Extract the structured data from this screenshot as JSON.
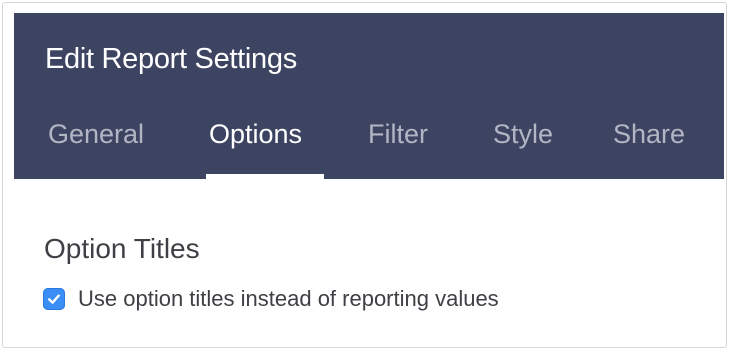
{
  "header": {
    "title": "Edit Report Settings",
    "tabs": [
      {
        "label": "General",
        "active": false
      },
      {
        "label": "Options",
        "active": true
      },
      {
        "label": "Filter",
        "active": false
      },
      {
        "label": "Style",
        "active": false
      },
      {
        "label": "Share",
        "active": false
      }
    ]
  },
  "content": {
    "section_title": "Option Titles",
    "option_titles_checkbox": {
      "label": "Use option titles instead of reporting values",
      "checked": true,
      "icon": "checkmark-icon"
    }
  },
  "colors": {
    "header_bg": "#3d4462",
    "tab_inactive": "#b2b6c4",
    "tab_active": "#ffffff",
    "checkbox_blue": "#3a8ef6",
    "body_text": "#3f4045"
  }
}
